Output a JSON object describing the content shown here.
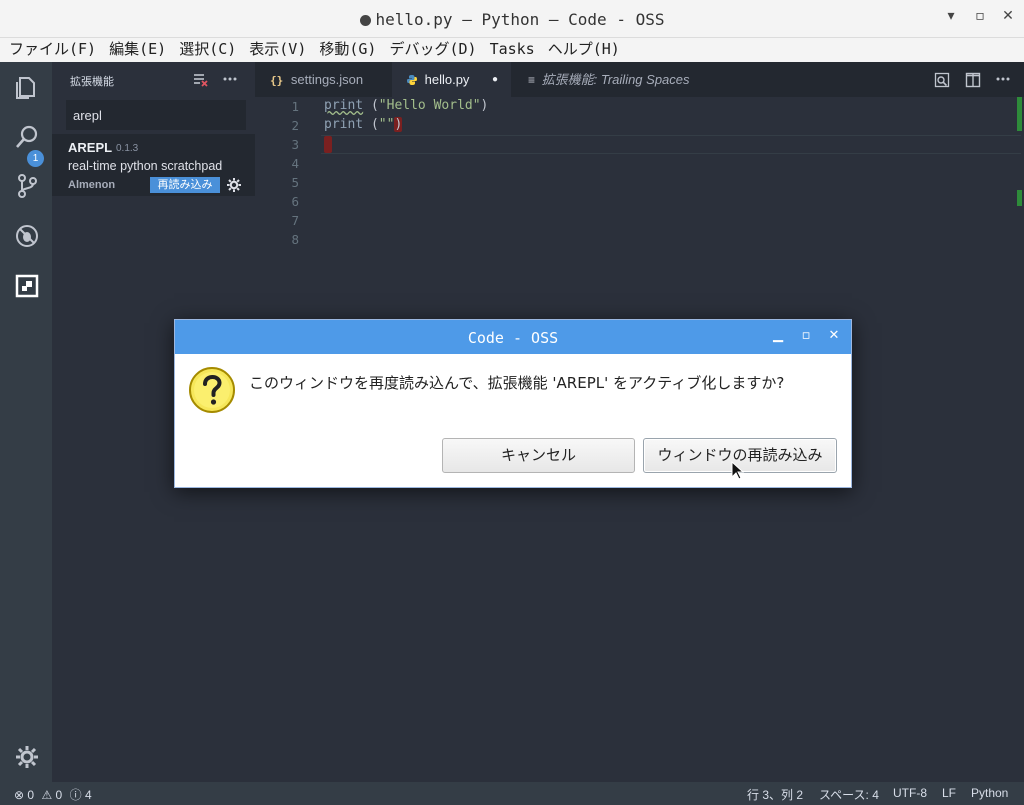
{
  "window": {
    "title": "hello.py — Python — Code - OSS",
    "minimize": "▾",
    "maximize": "▫",
    "close": "✕"
  },
  "menu": [
    "ファイル(F)",
    "編集(E)",
    "選択(C)",
    "表示(V)",
    "移動(G)",
    "デバッグ(D)",
    "Tasks",
    "ヘルプ(H)"
  ],
  "activity": {
    "badge": "1",
    "icons": [
      "files-icon",
      "search-icon",
      "source-control-icon",
      "debug-icon",
      "extensions-icon",
      "settings-gear-icon"
    ]
  },
  "sidebar": {
    "title": "拡張機能",
    "search_value": "arepl",
    "extension": {
      "name": "AREPL",
      "version": "0.1.3",
      "description": "real-time python scratchpad",
      "author": "Almenon",
      "reload_label": "再読み込み"
    }
  },
  "tabs": [
    {
      "label": "settings.json",
      "icon": "braces-icon"
    },
    {
      "label": "hello.py",
      "icon": "python-icon",
      "dirty": "●"
    },
    {
      "label_prefix": "拡張機能:",
      "label": " Trailing Spaces",
      "icon": "list-icon"
    }
  ],
  "editor": {
    "line_numbers": [
      "1",
      "2",
      "3",
      "4",
      "5",
      "6",
      "7",
      "8"
    ],
    "lines": [
      {
        "kw": "print",
        "rest": " (",
        "str": "\"Hello World\"",
        "end": ")"
      },
      {
        "kw": "print",
        "rest": " (",
        "str": "\"\"",
        "end": ")"
      }
    ]
  },
  "statusbar": {
    "errors": "0",
    "warnings": "0",
    "infos": "4",
    "position": "行 3、列 2",
    "spaces": "スペース: 4",
    "encoding": "UTF-8",
    "eol": "LF",
    "language": "Python"
  },
  "dialog": {
    "title": "Code - OSS",
    "message": "このウィンドウを再度読み込んで、拡張機能 'AREPL' をアクティブ化しますか?",
    "cancel_label": "キャンセル",
    "reload_label": "ウィンドウの再読み込み",
    "minimize": "▁",
    "maximize": "▫",
    "close": "✕"
  }
}
